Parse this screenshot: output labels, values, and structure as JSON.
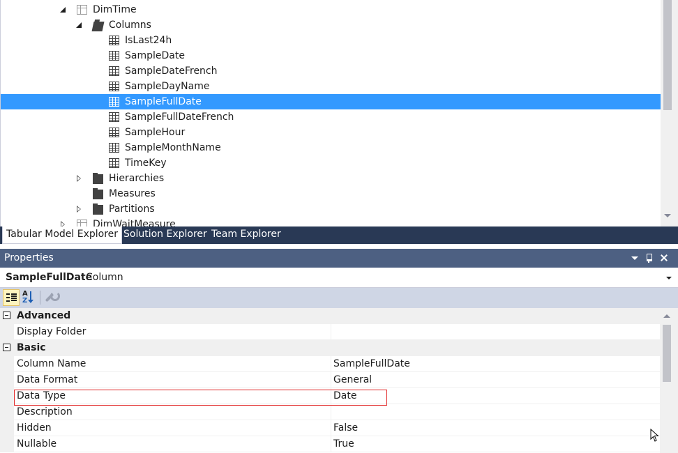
{
  "explorer": {
    "tree": [
      {
        "label": "DimTime",
        "icon": "table-icon",
        "expander": "open",
        "level": 0
      },
      {
        "label": "Columns",
        "icon": "folder-open-icon",
        "expander": "open",
        "level": 1
      },
      {
        "label": "IsLast24h",
        "icon": "column-icon",
        "expander": "none",
        "level": 2
      },
      {
        "label": "SampleDate",
        "icon": "column-icon",
        "expander": "none",
        "level": 2
      },
      {
        "label": "SampleDateFrench",
        "icon": "column-icon",
        "expander": "none",
        "level": 2
      },
      {
        "label": "SampleDayName",
        "icon": "column-icon",
        "expander": "none",
        "level": 2
      },
      {
        "label": "SampleFullDate",
        "icon": "column-icon",
        "expander": "none",
        "level": 2,
        "selected": true
      },
      {
        "label": "SampleFullDateFrench",
        "icon": "column-icon",
        "expander": "none",
        "level": 2
      },
      {
        "label": "SampleHour",
        "icon": "column-icon",
        "expander": "none",
        "level": 2
      },
      {
        "label": "SampleMonthName",
        "icon": "column-icon",
        "expander": "none",
        "level": 2
      },
      {
        "label": "TimeKey",
        "icon": "column-icon",
        "expander": "none",
        "level": 2
      },
      {
        "label": "Hierarchies",
        "icon": "folder-icon",
        "expander": "closed",
        "level": 1
      },
      {
        "label": "Measures",
        "icon": "folder-icon",
        "expander": "none",
        "level": 1
      },
      {
        "label": "Partitions",
        "icon": "folder-icon",
        "expander": "closed",
        "level": 1
      },
      {
        "label": "DimWaitMeasure",
        "icon": "table-icon",
        "expander": "closed",
        "level": 0
      }
    ],
    "tabs": [
      {
        "label": "Tabular Model Explorer",
        "active": true
      },
      {
        "label": "Solution Explorer",
        "active": false
      },
      {
        "label": "Team Explorer",
        "active": false
      }
    ]
  },
  "properties": {
    "title": "Properties",
    "object_name": "SampleFullDate",
    "object_type": "Column",
    "categories": [
      {
        "name": "Advanced",
        "items": [
          {
            "name": "Display Folder",
            "value": ""
          }
        ]
      },
      {
        "name": "Basic",
        "items": [
          {
            "name": "Column Name",
            "value": "SampleFullDate"
          },
          {
            "name": "Data Format",
            "value": "General"
          },
          {
            "name": "Data Type",
            "value": "Date",
            "highlighted": true
          },
          {
            "name": "Description",
            "value": ""
          },
          {
            "name": "Hidden",
            "value": "False"
          },
          {
            "name": "Nullable",
            "value": "True"
          }
        ]
      }
    ]
  },
  "colors": {
    "selection": "#3399ff",
    "tab_strip": "#293955",
    "panel_title": "#4d6082",
    "toolbar": "#cfd6e5",
    "highlight_box": "#e02020"
  }
}
